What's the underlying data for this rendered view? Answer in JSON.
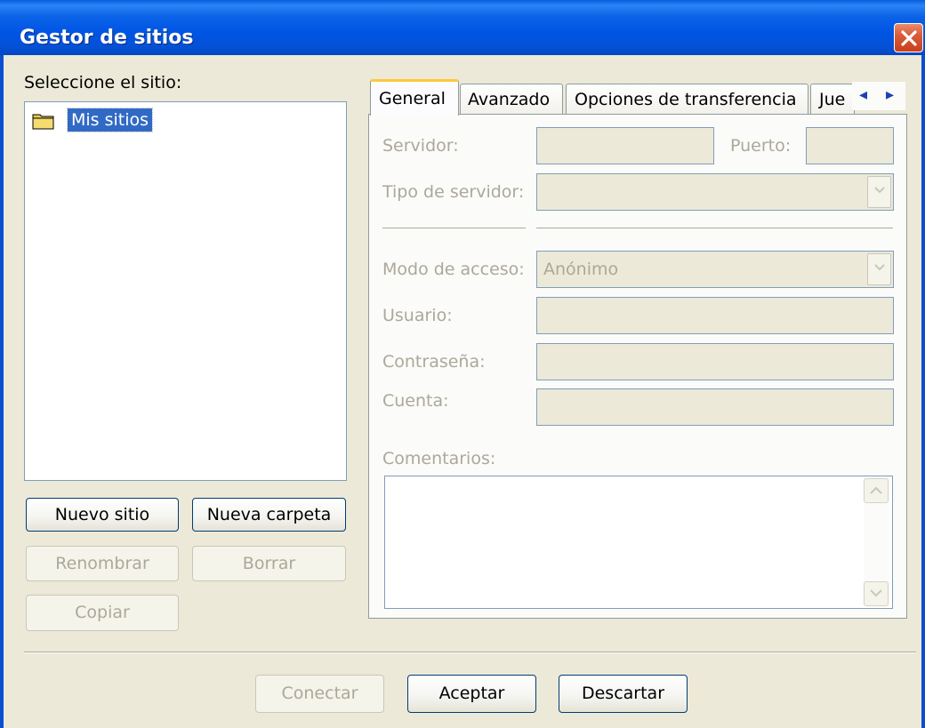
{
  "window": {
    "title": "Gestor de sitios"
  },
  "left": {
    "select_label": "Seleccione el sitio:",
    "tree_root": "Mis sitios",
    "new_site": "Nuevo sitio",
    "new_folder": "Nueva carpeta",
    "rename": "Renombrar",
    "delete": "Borrar",
    "copy": "Copiar"
  },
  "tabs": [
    "General",
    "Avanzado",
    "Opciones de transferencia",
    "Jue"
  ],
  "general": {
    "server_label": "Servidor:",
    "port_label": "Puerto:",
    "server_type_label": "Tipo de servidor:",
    "access_mode_label": "Modo de acceso:",
    "access_mode_value": "Anónimo",
    "user_label": "Usuario:",
    "password_label": "Contraseña:",
    "account_label": "Cuenta:",
    "comments_label": "Comentarios:"
  },
  "footer": {
    "connect": "Conectar",
    "accept": "Aceptar",
    "discard": "Descartar"
  }
}
